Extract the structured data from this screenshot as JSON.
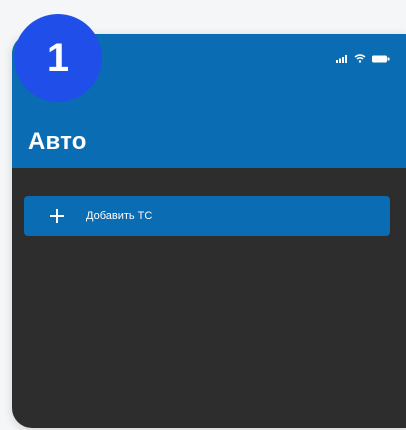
{
  "step_badge": {
    "number": "1",
    "color": "#1f4fe8"
  },
  "status_bar": {
    "icons": [
      "signal-icon",
      "wifi-icon",
      "battery-icon"
    ]
  },
  "header": {
    "title": "Авто",
    "color": "#0a6cb3"
  },
  "main": {
    "add_vehicle_button": {
      "label": "Добавить ТС",
      "icon": "plus-icon"
    },
    "background_color": "#2d2d2d"
  }
}
